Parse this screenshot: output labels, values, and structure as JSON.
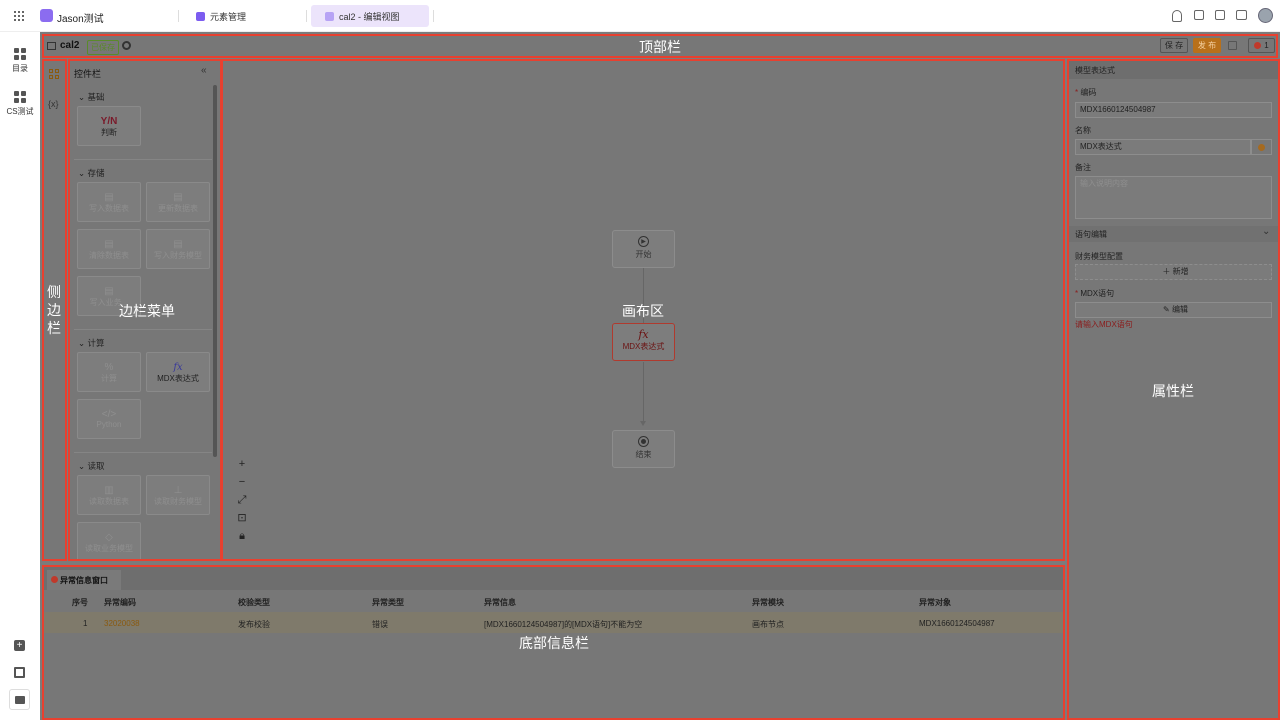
{
  "topbar": {
    "workspace": "Jason测试",
    "tabs": [
      {
        "label": "元素管理"
      },
      {
        "label": "cal2 - 编辑视图"
      }
    ]
  },
  "rail": {
    "items": [
      {
        "label": "目录"
      },
      {
        "label": "CS测试"
      }
    ]
  },
  "header": {
    "title": "cal2",
    "saved_badge": "已保存",
    "save_label": "保 存",
    "publish_label": "发 布",
    "error_count": "1"
  },
  "palette": {
    "title": "控件栏",
    "sections": [
      {
        "title": "基础",
        "items": [
          "判断"
        ]
      },
      {
        "title": "存储",
        "items": [
          "写入数据表",
          "更新数据表",
          "清除数据表",
          "写入财务模型",
          "写入业务..."
        ]
      },
      {
        "title": "计算",
        "items": [
          "计算",
          "MDX表达式",
          "Python"
        ]
      },
      {
        "title": "读取",
        "items": [
          "读取数据表",
          "读取财务模型",
          "读取业务模型"
        ]
      }
    ],
    "judge_symbol": "Y/N",
    "fx_symbol": "fx"
  },
  "canvas": {
    "nodes": {
      "start": "开始",
      "mdx": "MDX表达式",
      "end": "结束"
    }
  },
  "props": {
    "panel_title": "模型表达式",
    "code_label": "编码",
    "code_value": "MDX1660124504987",
    "name_label": "名称",
    "name_value": "MDX表达式",
    "note_label": "备注",
    "note_placeholder": "输入说明内容",
    "stmt_section": "语句编辑",
    "fin_config_label": "财务模型配置",
    "add_label": "新增",
    "mdx_label": "MDX语句",
    "edit_label": "编辑",
    "error_text": "请输入MDX语句"
  },
  "bottom": {
    "tab_label": "异常信息窗口",
    "columns": [
      "序号",
      "异常编码",
      "校验类型",
      "异常类型",
      "异常信息",
      "异常模块",
      "异常对象"
    ],
    "rows": [
      [
        "1",
        "32020038",
        "发布校验",
        "错误",
        "[MDX1660124504987]的[MDX语句]不能为空",
        "画布节点",
        "MDX1660124504987"
      ]
    ]
  },
  "overlay_labels": {
    "top": "顶部栏",
    "side": "侧边栏",
    "menu": "边栏菜单",
    "canvas": "画布区",
    "props": "属性栏",
    "bottom": "底部信息栏"
  },
  "colors": {
    "highlight_border": "#e8402f",
    "accent_purple": "#7c5cf0",
    "error_red": "#c0392b",
    "publish_orange": "#b8701a"
  }
}
